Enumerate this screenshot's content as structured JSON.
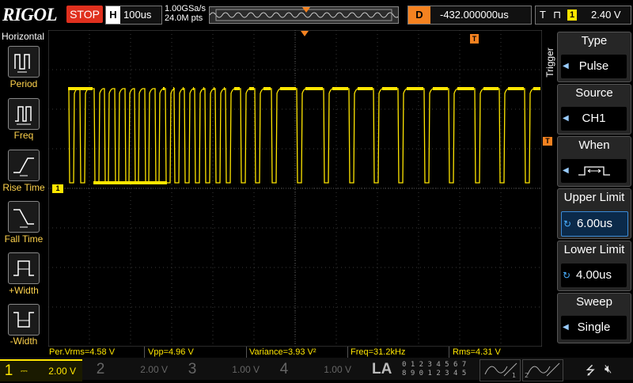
{
  "topbar": {
    "brand": "RIGOL",
    "run_status": "STOP",
    "horizontal_key": "H",
    "timebase": "100us",
    "sample_rate": "1.00GSa/s",
    "memory_depth": "24.0M pts",
    "delay_key": "D",
    "delay_value": "-432.000000us",
    "trigger_key": "T",
    "trigger_source_chip": "1",
    "trigger_level": "2.40 V"
  },
  "left_panel": {
    "title": "Horizontal",
    "items": [
      {
        "label": "Period",
        "icon": "period-icon"
      },
      {
        "label": "Freq",
        "icon": "frequency-icon"
      },
      {
        "label": "Rise Time",
        "icon": "rise-time-icon"
      },
      {
        "label": "Fall Time",
        "icon": "fall-time-icon"
      },
      {
        "label": "+Width",
        "icon": "positive-width-icon"
      },
      {
        "label": "-Width",
        "icon": "negative-width-icon"
      }
    ]
  },
  "right_menu": {
    "tab_label": "Trigger",
    "items": [
      {
        "title": "Type",
        "value": "Pulse"
      },
      {
        "title": "Source",
        "value": "CH1"
      },
      {
        "title": "When",
        "value": "",
        "icon": "pulse-width-range-icon"
      },
      {
        "title": "Upper Limit",
        "value": "6.00us"
      },
      {
        "title": "Lower Limit",
        "value": "4.00us"
      },
      {
        "title": "Sweep",
        "value": "Single"
      }
    ]
  },
  "measurements": [
    "Per.Vrms=4.58 V",
    "Vpp=4.96 V",
    "Variance=3.93 V²",
    "Freq=31.2kHz",
    "Rms=4.31 V"
  ],
  "channels": [
    {
      "num": "1",
      "scale": "2.00 V",
      "color": "#ffe600"
    },
    {
      "num": "2",
      "scale": "2.00 V",
      "color": "#00c8ff"
    },
    {
      "num": "3",
      "scale": "1.00 V",
      "color": "#ff00ff"
    },
    {
      "num": "4",
      "scale": "1.00 V",
      "color": "#2a6cff"
    }
  ],
  "la": {
    "label": "LA",
    "digits_row1": "0 1 2 3   4 5 6 7",
    "digits_row2": "8 9 0 1   2 3 4 5"
  },
  "markers": {
    "ch1_marker": "1",
    "trigger_marker": "T"
  },
  "colors": {
    "ch1": "#ffe600",
    "accent_orange": "#f58220",
    "stop_red": "#e0301e"
  }
}
